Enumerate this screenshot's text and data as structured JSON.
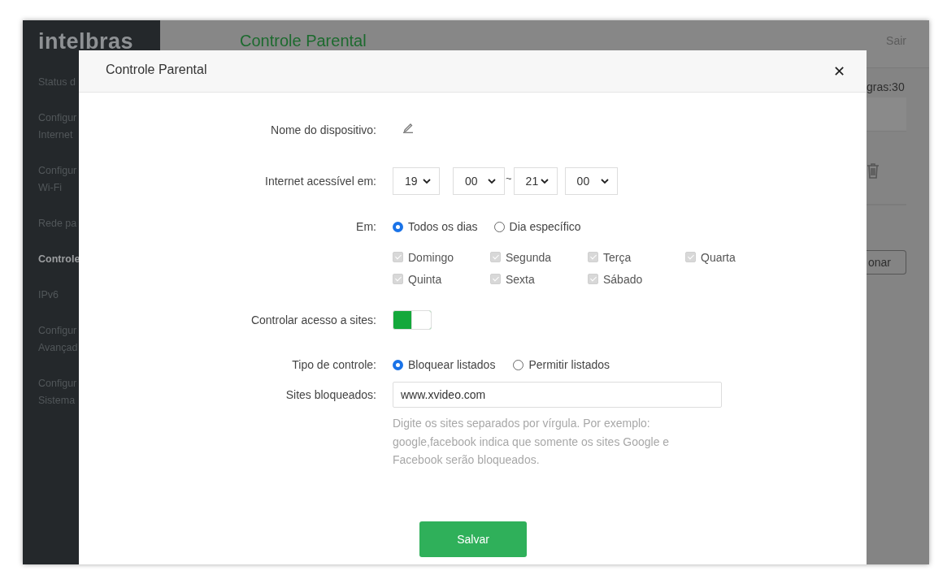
{
  "app": {
    "logo": "intelbras",
    "page_title": "Controle Parental",
    "logout": "Sair"
  },
  "sidebar": {
    "items": [
      {
        "lines": [
          "Status d"
        ],
        "selected": false
      },
      {
        "lines": [
          "Configur",
          "Internet"
        ],
        "selected": false
      },
      {
        "lines": [
          "Configur",
          "Wi-Fi"
        ],
        "selected": false
      },
      {
        "lines": [
          "Rede pa"
        ],
        "selected": false
      },
      {
        "lines": [
          "Controle"
        ],
        "selected": true
      },
      {
        "lines": [
          "IPv6"
        ],
        "selected": false
      },
      {
        "lines": [
          "Configur",
          "Avançad"
        ],
        "selected": false
      },
      {
        "lines": [
          "Configur",
          "Sistema"
        ],
        "selected": false
      }
    ]
  },
  "background": {
    "rules_count": "gras:30",
    "add_button": "onar"
  },
  "dialog": {
    "title": "Controle Parental",
    "close": "✕",
    "device_name": {
      "label": "Nome do dispositivo:"
    },
    "access_time": {
      "label": "Internet acessível em:",
      "selects": [
        {
          "value": "19"
        },
        {
          "value": "00"
        },
        {
          "value": "21"
        },
        {
          "value": "00"
        }
      ],
      "separator": "~"
    },
    "days": {
      "label": "Em:",
      "modes": [
        {
          "label": "Todos os dias",
          "selected": true
        },
        {
          "label": "Dia específico",
          "selected": false
        }
      ],
      "items": [
        {
          "label": "Domingo",
          "checked": true,
          "disabled": true
        },
        {
          "label": "Segunda",
          "checked": true,
          "disabled": true
        },
        {
          "label": "Terça",
          "checked": true,
          "disabled": true
        },
        {
          "label": "Quarta",
          "checked": true,
          "disabled": true
        },
        {
          "label": "Quinta",
          "checked": true,
          "disabled": true
        },
        {
          "label": "Sexta",
          "checked": true,
          "disabled": true
        },
        {
          "label": "Sábado",
          "checked": true,
          "disabled": true
        }
      ]
    },
    "site_control": {
      "label": "Controlar acesso a sites:",
      "on": true
    },
    "control_type": {
      "label": "Tipo de controle:",
      "options": [
        {
          "label": "Bloquear listados",
          "selected": true
        },
        {
          "label": "Permitir listados",
          "selected": false
        }
      ]
    },
    "blocked_sites": {
      "label": "Sites bloqueados:",
      "value": "www.xvideo.com",
      "hint": "Digite os sites separados por vírgula. Por exemplo: google,facebook indica que somente os sites Google e Facebook serão bloqueados."
    },
    "save_button": "Salvar"
  }
}
